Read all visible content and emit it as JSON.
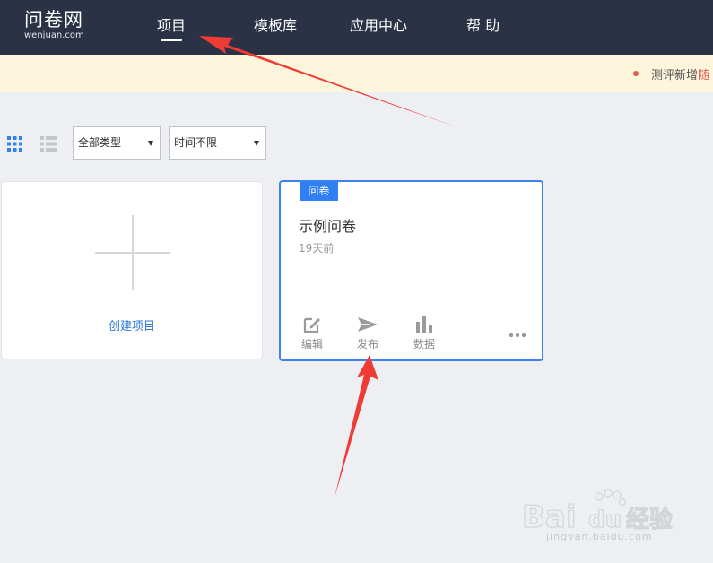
{
  "header": {
    "logo_main": "问卷网",
    "logo_sub": "wenjuan.com",
    "nav": [
      {
        "label": "项目",
        "active": true
      },
      {
        "label": "模板库"
      },
      {
        "label": "应用中心"
      },
      {
        "label": "帮 助"
      }
    ]
  },
  "notice": {
    "text": "测评新增",
    "highlight": "随"
  },
  "toolbar": {
    "view_grid_icon": "grid-view-icon",
    "view_list_icon": "list-view-icon",
    "type_filter": "全部类型",
    "time_filter": "时间不限"
  },
  "cards": {
    "create_label": "创建项目",
    "survey": {
      "badge": "问卷",
      "title": "示例问卷",
      "time": "19天前",
      "actions": [
        {
          "label": "编辑",
          "icon": "edit-icon"
        },
        {
          "label": "发布",
          "icon": "send-icon"
        },
        {
          "label": "数据",
          "icon": "bar-chart-icon"
        }
      ],
      "more_icon": "more-icon"
    }
  },
  "watermark": {
    "brand": "Bai",
    "brand2": "du",
    "suffix": "经验",
    "url": "jingyan.baidu.com"
  },
  "colors": {
    "header_bg": "#2b3245",
    "notice_bg": "#fdf6dc",
    "accent": "#2f80f2",
    "annotation_arrow": "#ee3b36"
  }
}
